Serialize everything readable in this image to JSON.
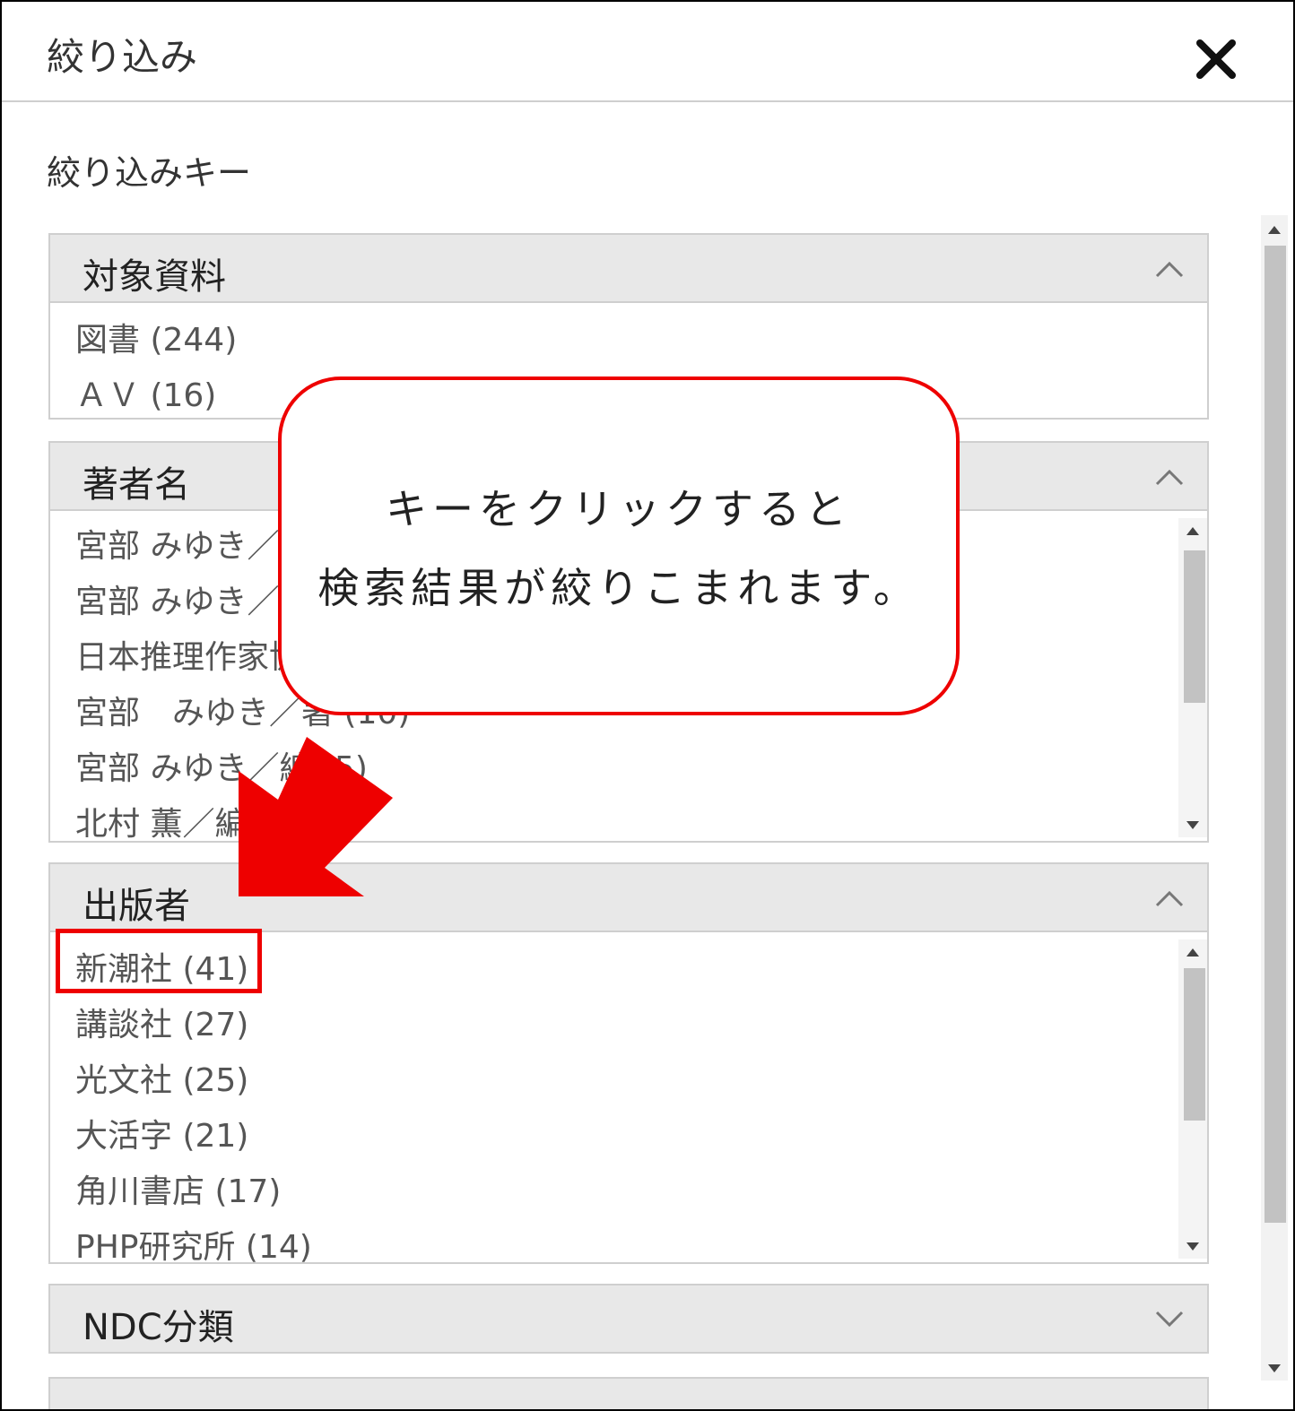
{
  "header": {
    "title": "絞り込み"
  },
  "filter_section_label": "絞り込みキー",
  "panels": [
    {
      "title": "対象資料",
      "expanded": true,
      "items": [
        "図書 (244)",
        "ＡＶ (16)"
      ]
    },
    {
      "title": "著者名",
      "expanded": true,
      "items": [
        "宮部 みゆき／",
        "宮部 みゆき／",
        "日本推理作家協",
        "宮部　みゆき／著 (10)",
        "宮部 みゆき／編 (5)",
        "北村 薫／編"
      ]
    },
    {
      "title": "出版者",
      "expanded": true,
      "items": [
        "新潮社 (41)",
        "講談社 (27)",
        "光文社 (25)",
        "大活字 (21)",
        "角川書店 (17)",
        "PHP研究所 (14)"
      ]
    },
    {
      "title": "NDC分類",
      "expanded": false,
      "items": []
    }
  ],
  "callout": {
    "line1": "キーをクリックすると",
    "line2": "検索結果が絞りこまれます。"
  },
  "icons": {
    "close": "close-icon",
    "collapse": "chevron-up-icon",
    "expand": "chevron-down-icon"
  },
  "colors": {
    "annotation": "#ee0000",
    "panel_header_bg": "#e8e8e8",
    "border": "#cfcfcf"
  }
}
